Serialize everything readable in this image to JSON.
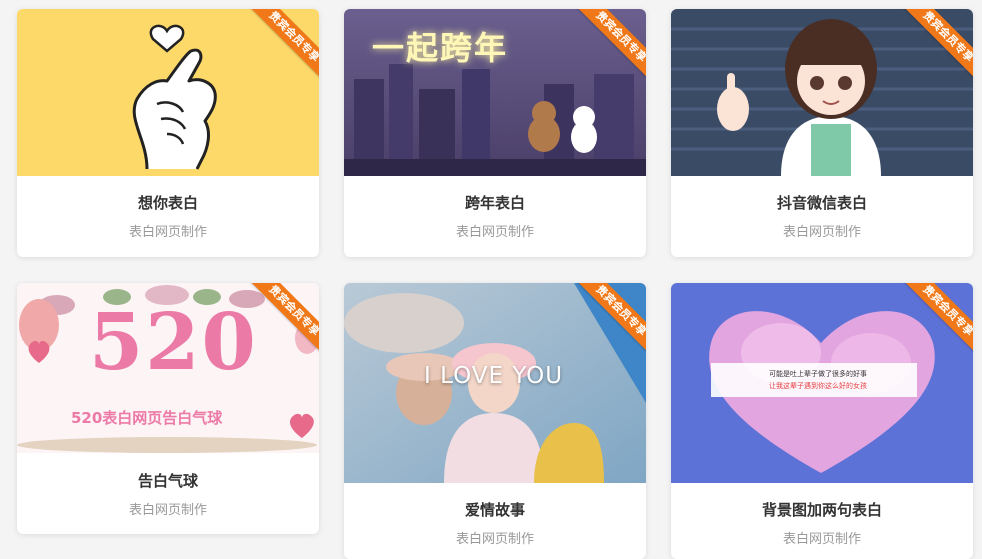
{
  "badge_text": "贵宾会员专享",
  "cards": [
    {
      "title": "想你表白",
      "subtitle": "表白网页制作"
    },
    {
      "title": "跨年表白",
      "subtitle": "表白网页制作",
      "image_text": "一起跨年"
    },
    {
      "title": "抖音微信表白",
      "subtitle": "表白网页制作"
    },
    {
      "title": "告白气球",
      "subtitle": "表白网页制作",
      "image_text": "520",
      "image_caption": "520表白网页告白气球"
    },
    {
      "title": "爱情故事",
      "subtitle": "表白网页制作",
      "image_text": "I LOVE YOU"
    },
    {
      "title": "背景图加两句表白",
      "subtitle": "表白网页制作",
      "image_line1": "可能是吐上辈子做了很多的好事",
      "image_line2": "让我这辈子遇到你这么好的女孩"
    }
  ],
  "colors": {
    "badge": "#f07818",
    "card1_bg": "#fdd96a",
    "card2_bg": "#5b4c7a",
    "card3_bg": "#3a4b66",
    "card6_bg": "#5d72d6"
  }
}
